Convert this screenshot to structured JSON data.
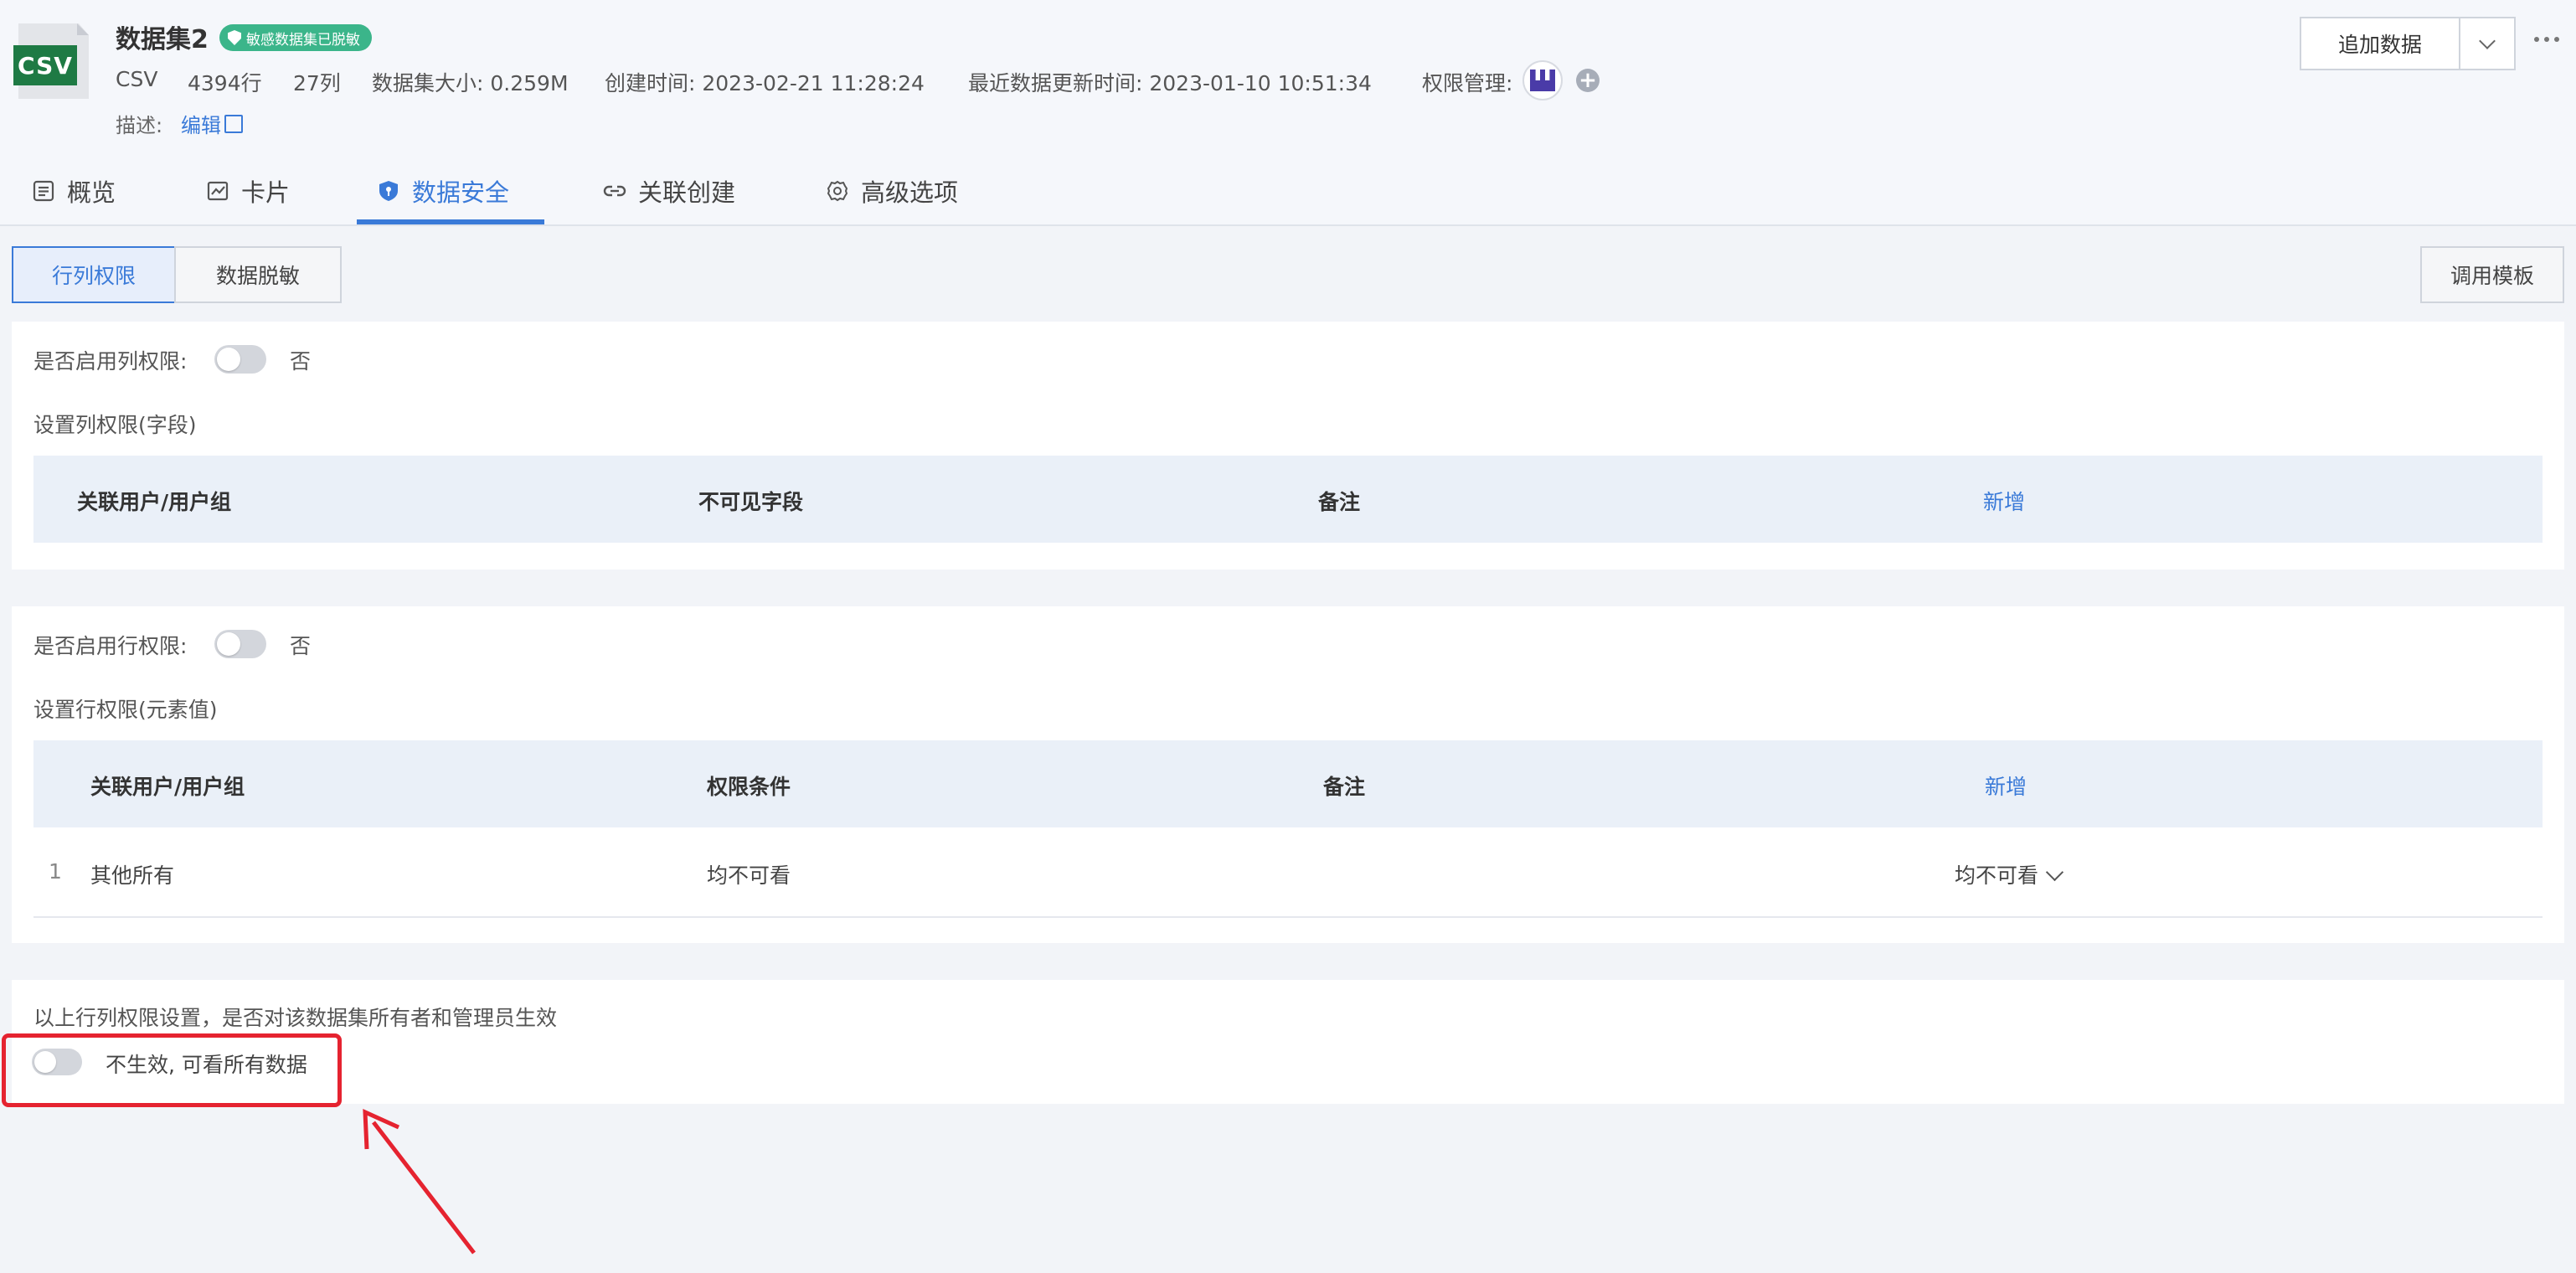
{
  "dataset": {
    "icon_label": "CSV",
    "title": "数据集2",
    "badge": "敏感数据集已脱敏",
    "meta": {
      "type": "CSV",
      "rows": "4394行",
      "cols": "27列",
      "size": "数据集大小: 0.259M",
      "created": "创建时间: 2023-02-21 11:28:24",
      "updated": "最近数据更新时间: 2023-01-10 10:51:34",
      "permission_label": "权限管理:"
    },
    "desc_label": "描述:",
    "desc_edit": "编辑"
  },
  "actions": {
    "add_data": "追加数据"
  },
  "tabs": [
    {
      "label": "概览",
      "icon": "list-icon"
    },
    {
      "label": "卡片",
      "icon": "chart-icon"
    },
    {
      "label": "数据安全",
      "icon": "shield-icon",
      "active": true
    },
    {
      "label": "关联创建",
      "icon": "link-icon"
    },
    {
      "label": "高级选项",
      "icon": "gear-icon"
    }
  ],
  "subtabs": {
    "row_col": "行列权限",
    "masking": "数据脱敏",
    "template": "调用模板"
  },
  "column_permission": {
    "enable_label": "是否启用列权限:",
    "enable_value": "否",
    "section_title": "设置列权限(字段)",
    "headers": [
      "关联用户/用户组",
      "不可见字段",
      "备注"
    ],
    "add": "新增"
  },
  "row_permission": {
    "enable_label": "是否启用行权限:",
    "enable_value": "否",
    "section_title": "设置行权限(元素值)",
    "headers": [
      "关联用户/用户组",
      "权限条件",
      "备注"
    ],
    "add": "新增",
    "rows": [
      {
        "index": "1",
        "user": "其他所有",
        "condition": "均不可看",
        "select": "均不可看"
      }
    ]
  },
  "owner_effect": {
    "question": "以上行列权限设置，是否对该数据集所有者和管理员生效",
    "toggle_text": "不生效, 可看所有数据"
  },
  "colors": {
    "accent": "#3a7ad8",
    "badge": "#3bb58a",
    "highlight": "#e52330",
    "csv_tag": "#1e7a44"
  }
}
